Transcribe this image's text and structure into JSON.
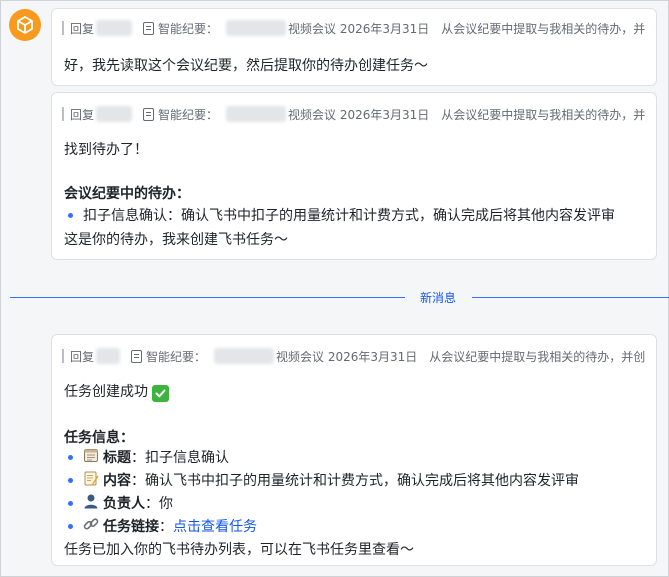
{
  "colors": {
    "accent": "#3370ff",
    "avatar_bg": "#f79a1d",
    "check_bg": "#3eb33d"
  },
  "messages": [
    {
      "quote": {
        "reply_label": "回复",
        "minutes_label": "智能纪要：",
        "meeting": "视频会议 2026年3月31日",
        "request": "从会议纪要中提取与我相关的待办，并创建..."
      },
      "body": "好，我先读取这个会议纪要，然后提取你的待办创建任务～"
    },
    {
      "quote": {
        "reply_label": "回复",
        "minutes_label": "智能纪要：",
        "meeting": "视频会议 2026年3月31日",
        "request": "从会议纪要中提取与我相关的待办，并创..."
      },
      "found": "找到待办了！",
      "section_title": "会议纪要中的待办：",
      "items": [
        "扣子信息确认：确认飞书中扣子的用量统计和计费方式，确认完成后将其他内容发评审"
      ],
      "footer": "这是你的待办，我来创建飞书任务～"
    },
    {
      "quote": {
        "reply_label": "回复",
        "minutes_label": "智能纪要：",
        "meeting": "视频会议 2026年3月31日",
        "request": "从会议纪要中提取与我相关的待办，并创..."
      },
      "status": "任务创建成功",
      "section_title": "任务信息：",
      "fields": [
        {
          "icon": "calendar-icon",
          "label": "标题",
          "value": "扣子信息确认"
        },
        {
          "icon": "memo-icon",
          "label": "内容",
          "value": "确认飞书中扣子的用量统计和计费方式，确认完成后将其他内容发评审"
        },
        {
          "icon": "person-icon",
          "label": "负责人",
          "value": "你"
        },
        {
          "icon": "link-icon",
          "label": "任务链接",
          "value": "点击查看任务"
        }
      ],
      "footer": "任务已加入你的飞书待办列表，可以在飞书任务里查看～"
    }
  ],
  "divider": {
    "label": "新消息"
  },
  "sep": "：",
  "sep2": "："
}
